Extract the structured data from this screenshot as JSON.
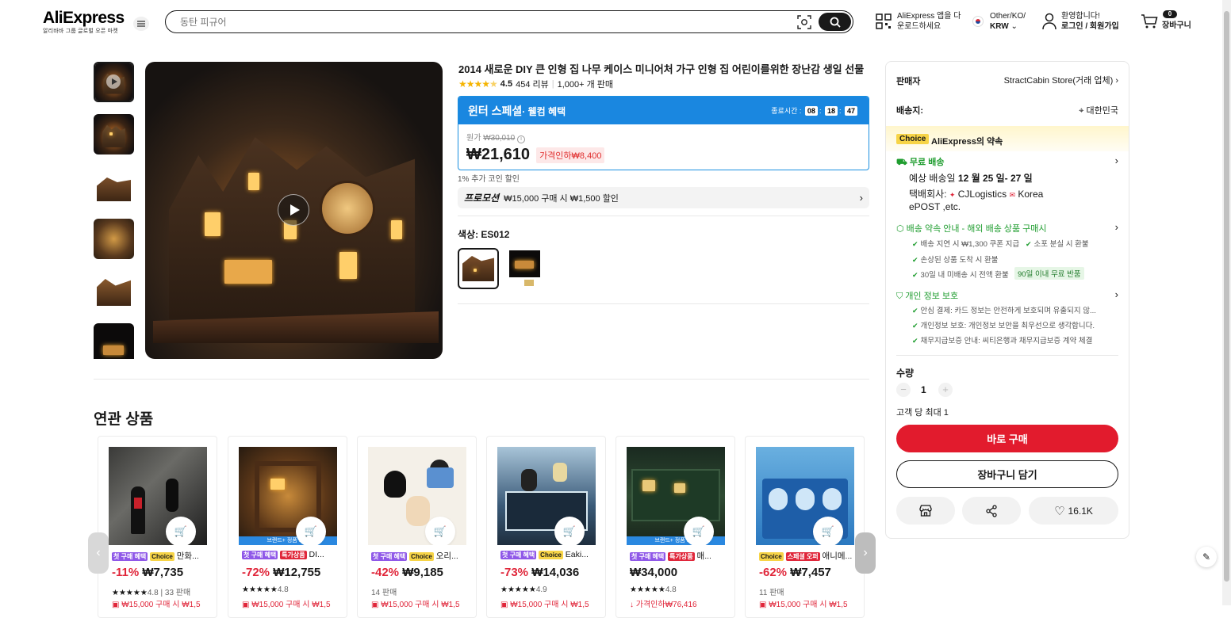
{
  "header": {
    "logo": "AliExpress",
    "logo_sub": "알리바바 그룹 글로벌 오픈 마켓",
    "search_placeholder": "동탄 피규어",
    "app_line1": "AliExpress 앱을 다",
    "app_line2": "운로드하세요",
    "region_line1": "Other/KO/",
    "region_line2": "KRW",
    "account_line1": "환영합니다!",
    "account_line2": "로그인 / 회원가입",
    "cart_count": "0",
    "cart_label": "장바구니"
  },
  "product": {
    "title": "2014 새로운 DIY 큰 인형 집 나무 케이스 미니어처 가구 인형 집 어린이를위한 장난감 생일 선물",
    "rating": "4.5",
    "reviews": "454 리뷰",
    "sold": "1,000+ 개 판매",
    "promo_title": "윈터 스페셜",
    "promo_sub": "· 웰컴 혜택",
    "countdown_label": "종료시간 :",
    "countdown": [
      "08",
      "18",
      "47"
    ],
    "orig_label": "원가",
    "orig_price": "₩30,010",
    "price": "₩21,610",
    "discount_tag": "가격인하₩8,400",
    "coin_note": "1% 추가 코인 할인",
    "promotion_label": "프로모션",
    "promotion_text": "₩15,000 구매 시 ₩1,500 할인",
    "color_label": "색상: ES012"
  },
  "panel": {
    "seller_label": "판매자",
    "seller_name": "StractCabin Store(거래 업체)",
    "ship_label": "배송지:",
    "ship_to": "대한민국",
    "choice_badge": "Choice",
    "choice_text": "AliExpress의 약속",
    "free_ship": "무료 배송",
    "eta_prefix": "예상 배송일",
    "eta": "12 월 25 일- 27 일",
    "carrier_label": "택배회사:",
    "carrier1": "CJLogistics",
    "carrier2": "Korea",
    "carrier3": "ePOST ,etc.",
    "guarantee_title": "배송 약속 안내 - 해외 배송 상품 구매시",
    "g1": "배송 지연 시 ₩1,300 쿠폰 지급",
    "g2": "소포 분실 시 환불",
    "g3": "손상된 상품 도착 시 환불",
    "g4": "30일 내 미배송 시 전액 환불",
    "g4_tag": "90일 이내 무료 반품",
    "privacy_title": "개인 정보 보호",
    "p1": "안심 결제: 카드 정보는 안전하게 보호되며 유출되지 않...",
    "p2": "개인정보 보호: 개인정보 보안을 최우선으로 생각합니다.",
    "p3": "채무지급보증 안내: 씨티은행과 채무지급보증 계약 체결",
    "qty_label": "수량",
    "qty_value": "1",
    "qty_max": "고객 당 최대 1",
    "buy_now": "바로 구매",
    "add_cart": "장바구니 담기",
    "wishlist_count": "16.1K"
  },
  "related": {
    "title": "연관 상품",
    "items": [
      {
        "tags": [
          "첫 구매 혜택",
          "Choice"
        ],
        "name": "만화...",
        "pct": "-11%",
        "price": "₩7,735",
        "rating": "4.8",
        "sold": "33 판매",
        "promo": "₩15,000 구매 시 ₩1,5"
      },
      {
        "tags": [
          "첫 구매 혜택",
          "특가상품"
        ],
        "name": "DI...",
        "pct": "-72%",
        "price": "₩12,755",
        "rating": "4.8",
        "sold": "",
        "promo": "₩15,000 구매 시 ₩1,5",
        "band": "브랜드+ 정품 보증"
      },
      {
        "tags": [
          "첫 구매 혜택",
          "Choice"
        ],
        "name": "오리...",
        "pct": "-42%",
        "price": "₩9,185",
        "rating": "",
        "sold": "14 판매",
        "promo": "₩15,000 구매 시 ₩1,5"
      },
      {
        "tags": [
          "첫 구매 혜택",
          "Choice"
        ],
        "name": "Eaki...",
        "pct": "-73%",
        "price": "₩14,036",
        "rating": "4.9",
        "sold": "",
        "promo": "₩15,000 구매 시 ₩1,5"
      },
      {
        "tags": [
          "첫 구매 혜택",
          "특가상품"
        ],
        "name": "매...",
        "pct": "",
        "price": "₩34,000",
        "rating": "4.8",
        "sold": "",
        "promo": "가격인하₩76,416",
        "band": "브랜드+ 정품 보증"
      },
      {
        "tags": [
          "Choice",
          "스페셜 오퍼"
        ],
        "name": "애니메...",
        "pct": "-62%",
        "price": "₩7,457",
        "rating": "",
        "sold": "11 판매",
        "promo": "₩15,000 구매 시 ₩1,5"
      }
    ]
  }
}
